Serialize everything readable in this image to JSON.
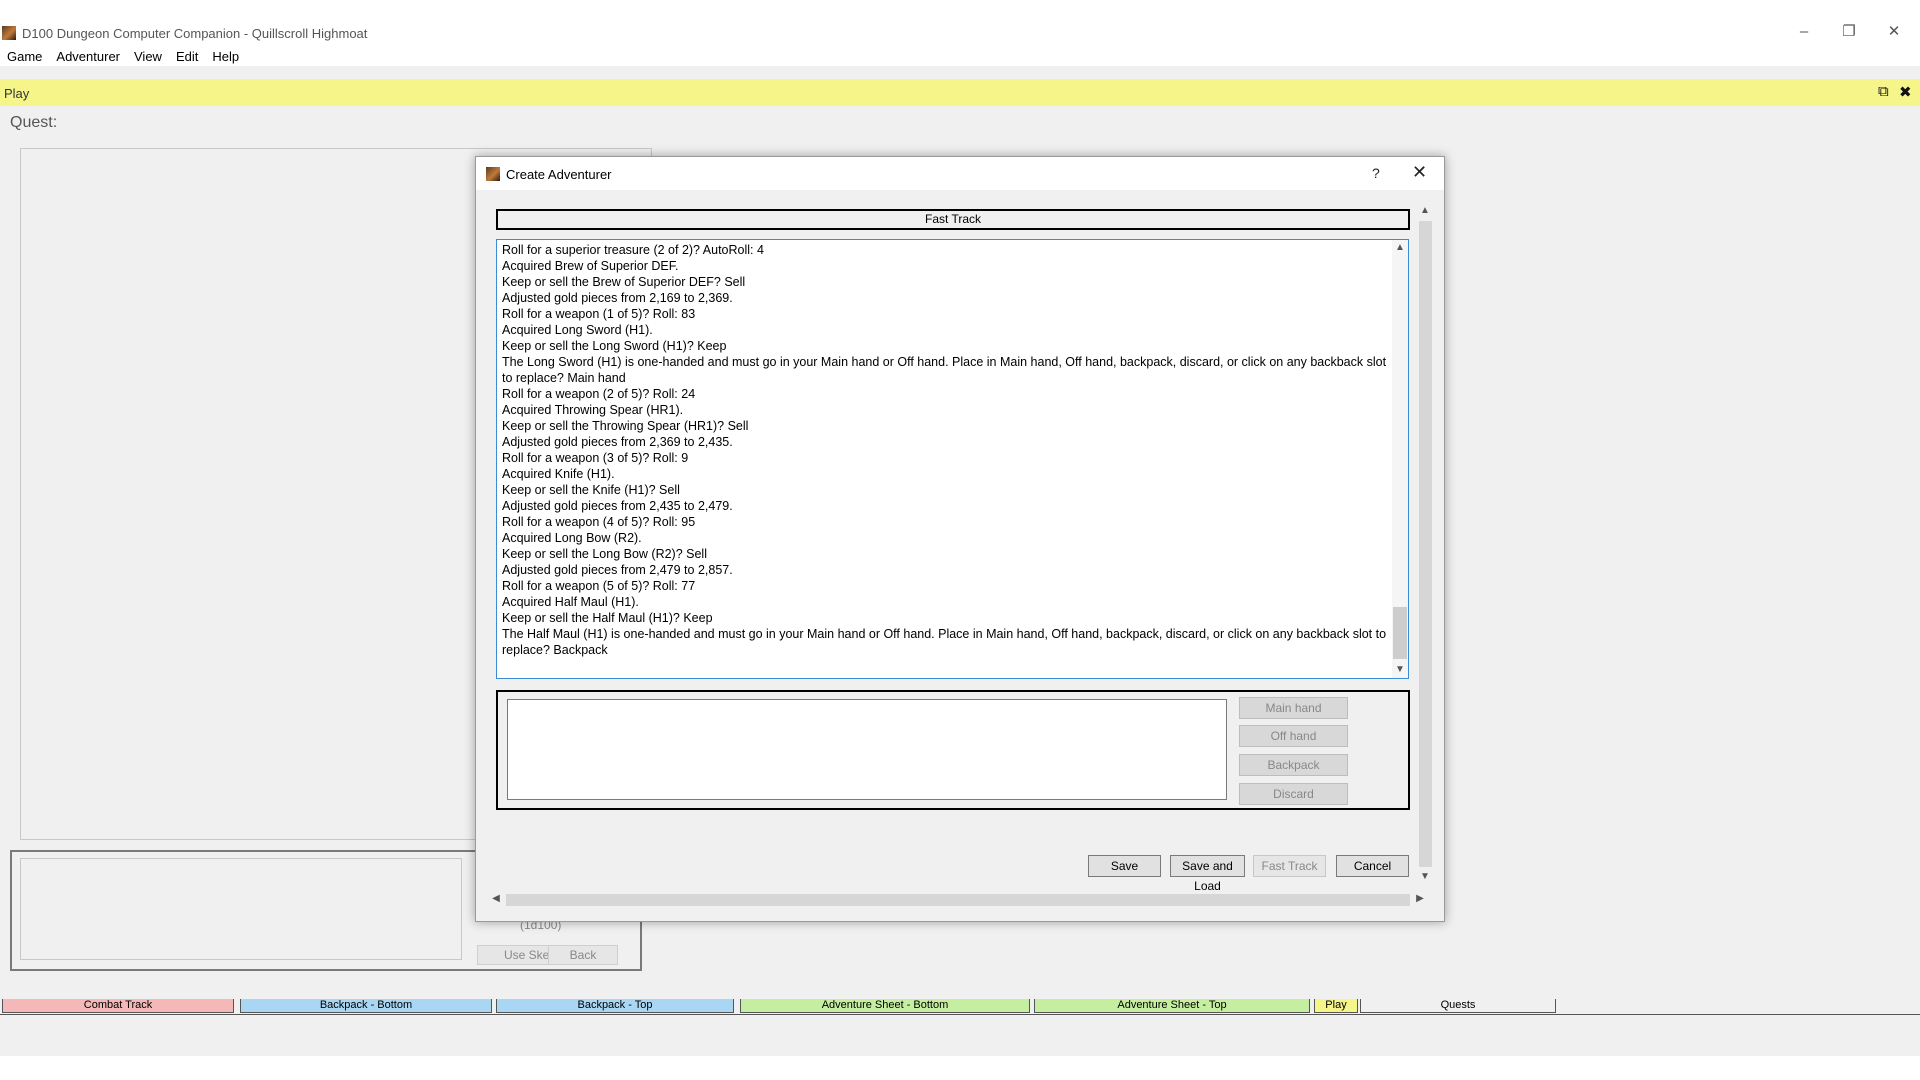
{
  "app": {
    "title": "D100 Dungeon Computer Companion - Quillscroll Highmoat",
    "window_controls": [
      "minimize-icon",
      "restore-icon",
      "close-icon"
    ]
  },
  "menu": [
    "Game",
    "Adventurer",
    "View",
    "Edit",
    "Help"
  ],
  "play_bar": {
    "label": "Play",
    "color": "#f6f58a"
  },
  "quest": {
    "label": "Quest:"
  },
  "background_panel": {
    "dice_label": "(1d100)",
    "use_skill_label": "Use Ske",
    "back_label": "Back"
  },
  "dialog": {
    "title": "Create Adventurer",
    "help_glyph": "?",
    "fast_track_banner": "Fast Track",
    "log": [
      "Roll for a superior treasure (2 of 2)? AutoRoll: 4",
      "Acquired Brew of Superior DEF.",
      "Keep or sell the Brew of Superior DEF? Sell",
      "Adjusted gold pieces from 2,169 to 2,369.",
      "Roll for a weapon (1 of 5)? Roll: 83",
      "Acquired Long Sword (H1).",
      "Keep or sell the Long Sword (H1)? Keep",
      "The Long Sword (H1) is one-handed and must go in your Main hand or Off hand. Place in Main hand, Off hand, backpack, discard, or click on any backback slot to replace? Main hand",
      "Roll for a weapon (2 of 5)? Roll: 24",
      "Acquired Throwing Spear (HR1).",
      "Keep or sell the Throwing Spear (HR1)? Sell",
      "Adjusted gold pieces from 2,369 to 2,435.",
      "Roll for a weapon (3 of 5)? Roll: 9",
      "Acquired Knife (H1).",
      "Keep or sell the Knife (H1)? Sell",
      "Adjusted gold pieces from 2,435 to 2,479.",
      "Roll for a weapon (4 of 5)? Roll: 95",
      "Acquired Long Bow (R2).",
      "Keep or sell the Long Bow (R2)? Sell",
      "Adjusted gold pieces from 2,479 to 2,857.",
      "Roll for a weapon (5 of 5)? Roll: 77",
      "Acquired Half Maul (H1).",
      "Keep or sell the Half Maul (H1)? Keep",
      "The Half Maul (H1) is one-handed and must go in your Main hand or Off hand. Place in Main hand, Off hand, backpack, discard, or click on any backback slot to replace? Backpack"
    ],
    "placement_buttons": {
      "main_hand": "Main hand",
      "off_hand": "Off hand",
      "backpack": "Backpack",
      "discard": "Discard"
    },
    "buttons": {
      "save": "Save",
      "save_and_load": "Save and Load",
      "fast_track": "Fast Track",
      "cancel": "Cancel"
    }
  },
  "tabs": [
    {
      "label": "Combat Track",
      "color": "#f4b8b8"
    },
    {
      "label": "Backpack - Bottom",
      "color": "#a9d6f2"
    },
    {
      "label": "Backpack - Top",
      "color": "#a9d6f2"
    },
    {
      "label": "Adventure Sheet - Bottom",
      "color": "#c6eea0"
    },
    {
      "label": "Adventure Sheet - Top",
      "color": "#c6eea0"
    },
    {
      "label": "Play",
      "color": "#f6f58a"
    },
    {
      "label": "Quests",
      "color": "#f0f0f0"
    }
  ]
}
